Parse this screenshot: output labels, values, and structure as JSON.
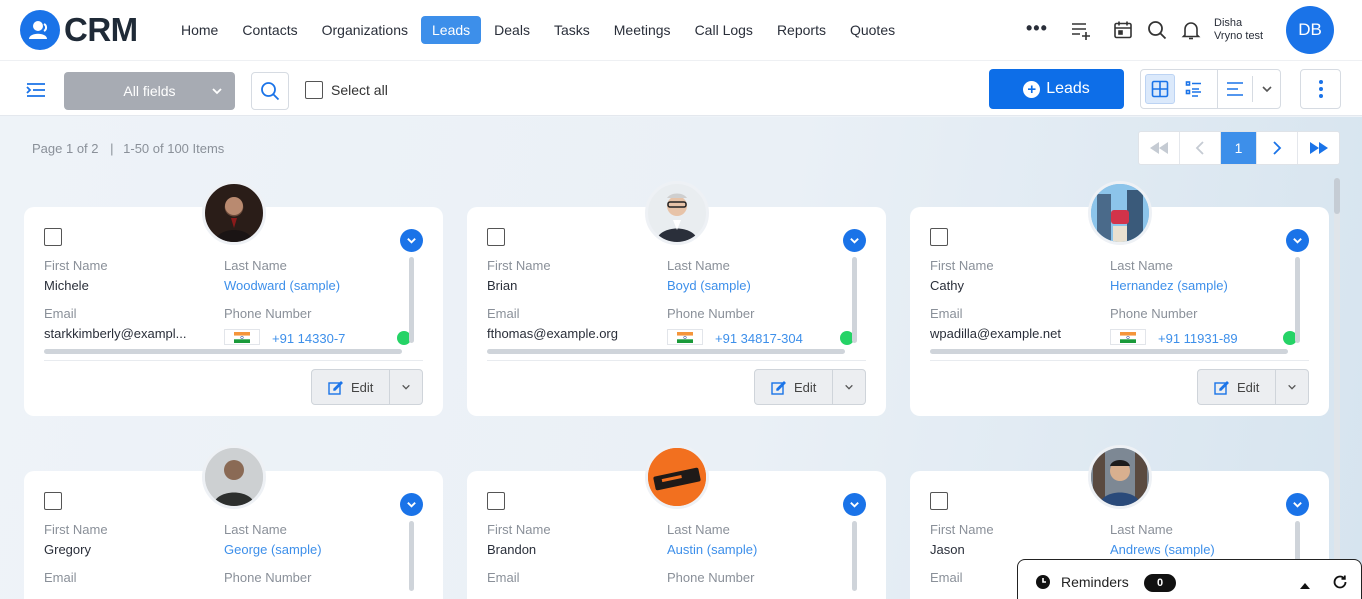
{
  "app": {
    "logo_text": "CRM"
  },
  "nav": {
    "items": [
      {
        "label": "Home"
      },
      {
        "label": "Contacts"
      },
      {
        "label": "Organizations"
      },
      {
        "label": "Leads",
        "active": true
      },
      {
        "label": "Deals"
      },
      {
        "label": "Tasks"
      },
      {
        "label": "Meetings"
      },
      {
        "label": "Call Logs"
      },
      {
        "label": "Reports"
      },
      {
        "label": "Quotes"
      }
    ],
    "more": "•••"
  },
  "user": {
    "name_line1": "Disha",
    "name_line2": "Vryno test",
    "initials": "DB"
  },
  "toolbar": {
    "field_select": "All fields",
    "select_all": "Select all",
    "add_button": "Leads"
  },
  "pagination": {
    "page_text": "Page 1 of 2",
    "items_text": "1-50 of 100 Items",
    "current": "1"
  },
  "labels": {
    "first_name": "First Name",
    "last_name": "Last Name",
    "email": "Email",
    "phone": "Phone Number",
    "edit": "Edit"
  },
  "cards": [
    {
      "first": "Michele",
      "last": "Woodward (sample)",
      "email": "starkkimberly@exampl...",
      "phone": "+91 14330-7"
    },
    {
      "first": "Brian",
      "last": "Boyd (sample)",
      "email": "fthomas@example.org",
      "phone": "+91 34817-304"
    },
    {
      "first": "Cathy",
      "last": "Hernandez (sample)",
      "email": "wpadilla@example.net",
      "phone": "+91 11931-89"
    },
    {
      "first": "Gregory",
      "last": "George (sample)"
    },
    {
      "first": "Brandon",
      "last": "Austin (sample)"
    },
    {
      "first": "Jason",
      "last": "Andrews (sample)"
    }
  ],
  "reminders": {
    "label": "Reminders",
    "count": "0"
  },
  "colors": {
    "primary": "#1a73e8",
    "active_nav": "#3d8fea",
    "whatsapp": "#25d366"
  }
}
